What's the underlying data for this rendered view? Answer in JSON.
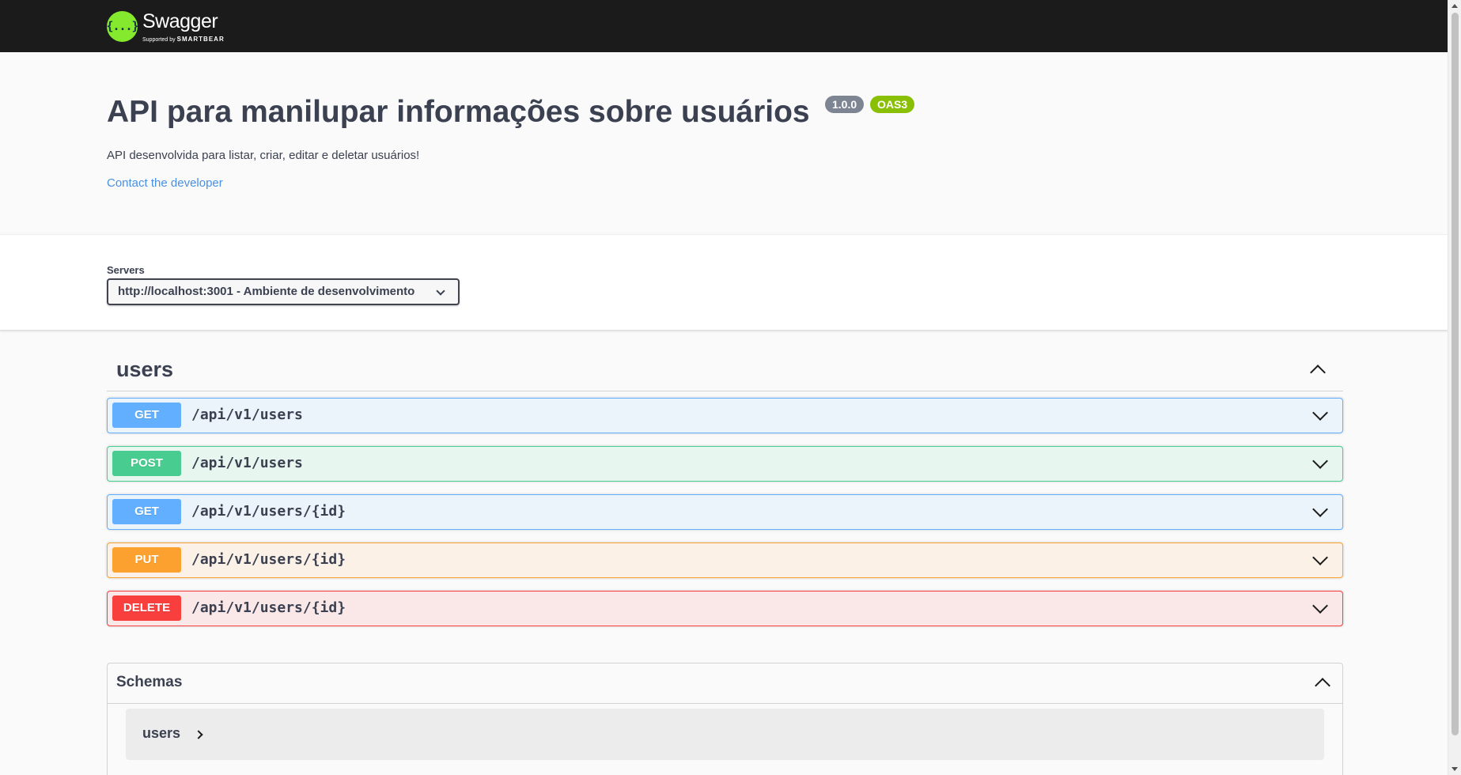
{
  "topbar": {
    "logo_name": "Swagger",
    "logo_supported": "Supported by",
    "logo_brand": "SMARTBEAR",
    "logo_icon": "{...}"
  },
  "info": {
    "title": "API para manilupar informações sobre usuários",
    "version": "1.0.0",
    "oas": "OAS3",
    "description": "API desenvolvida para listar, criar, editar e deletar usuários!",
    "contact": "Contact the developer"
  },
  "servers": {
    "label": "Servers",
    "selected": "http://localhost:3001 - Ambiente de desenvolvimento"
  },
  "tag": {
    "name": "users"
  },
  "operations": [
    {
      "method": "GET",
      "path": "/api/v1/users"
    },
    {
      "method": "POST",
      "path": "/api/v1/users"
    },
    {
      "method": "GET",
      "path": "/api/v1/users/{id}"
    },
    {
      "method": "PUT",
      "path": "/api/v1/users/{id}"
    },
    {
      "method": "DELETE",
      "path": "/api/v1/users/{id}"
    }
  ],
  "schemas": {
    "title": "Schemas",
    "models": [
      {
        "name": "users"
      }
    ]
  },
  "colors": {
    "get": "#61affe",
    "post": "#49cc90",
    "put": "#fca130",
    "delete": "#f93e3e",
    "topbar": "#1b1b1b",
    "logo": "#85ea2d"
  }
}
